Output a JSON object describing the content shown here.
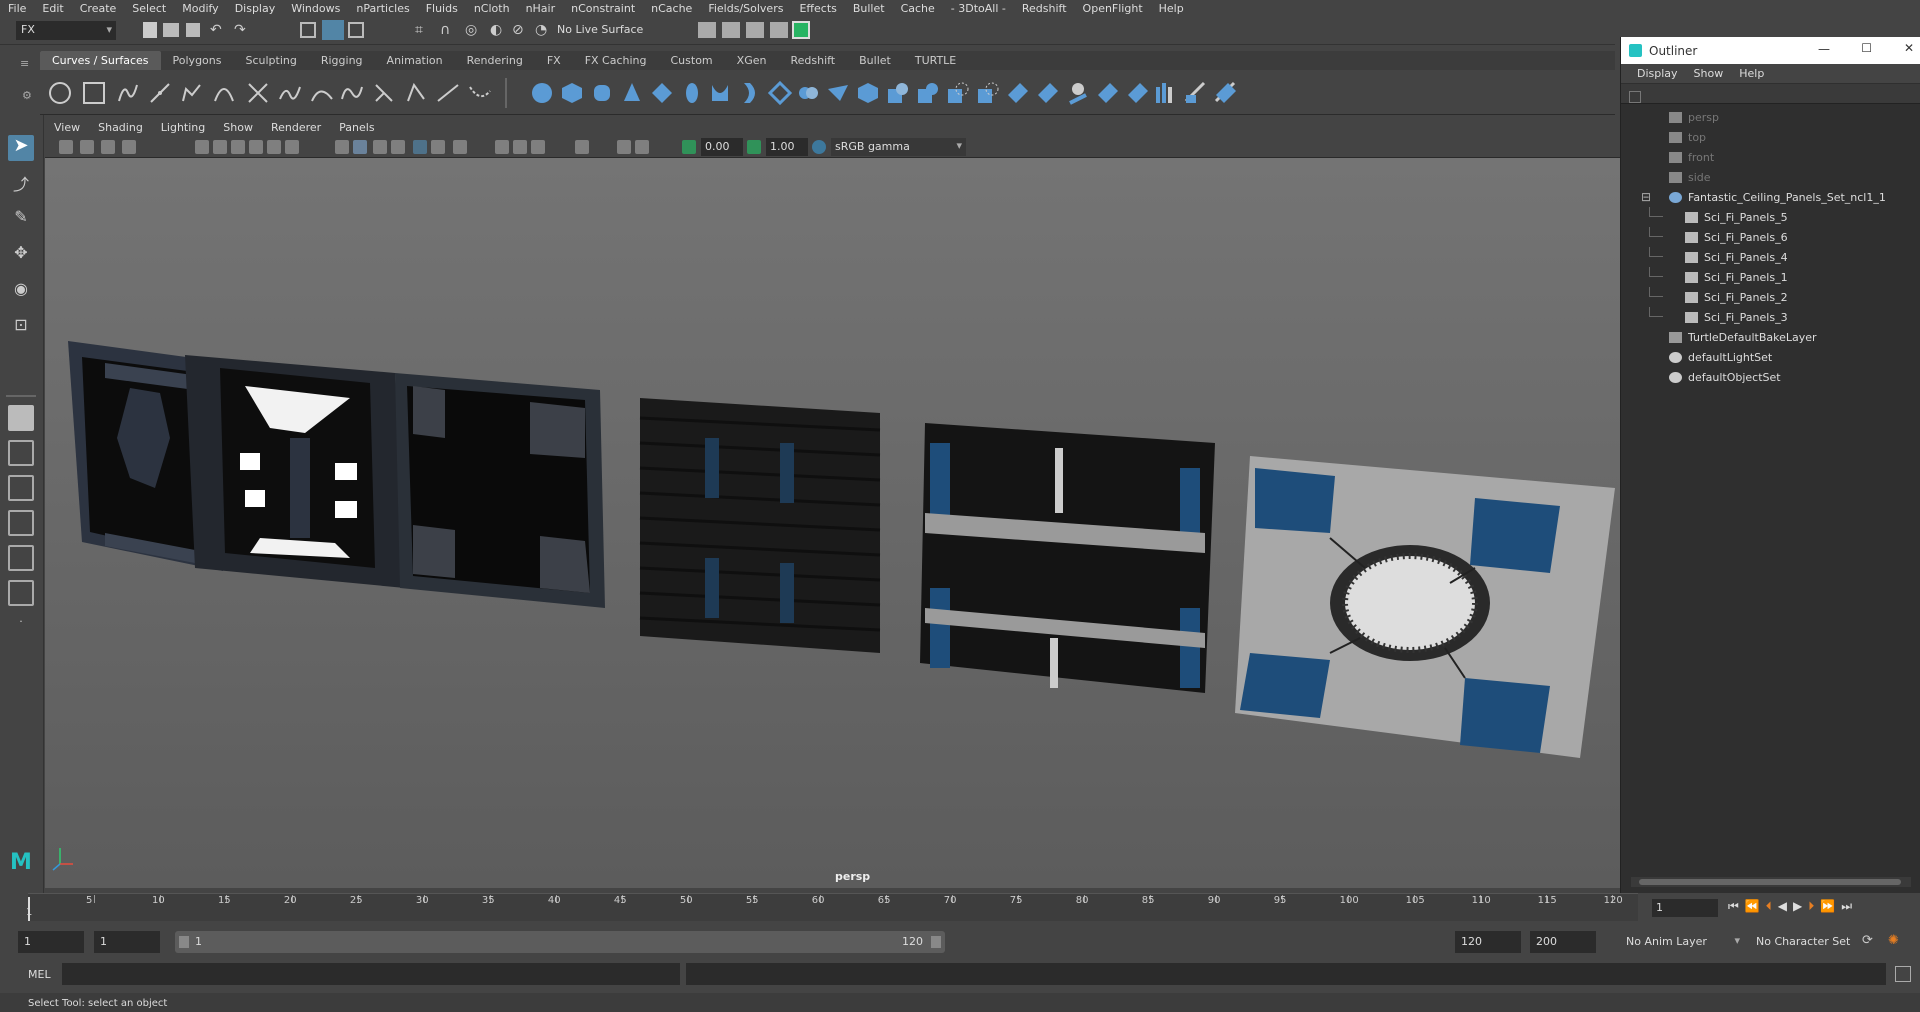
{
  "menubar": [
    "File",
    "Edit",
    "Create",
    "Select",
    "Modify",
    "Display",
    "Windows",
    "nParticles",
    "Fluids",
    "nCloth",
    "nHair",
    "nConstraint",
    "nCache",
    "Fields/Solvers",
    "Effects",
    "Bullet",
    "Cache",
    "- 3DtoAll -",
    "Redshift",
    "OpenFlight",
    "Help"
  ],
  "toolbar": {
    "menuset": "FX",
    "live_surface": "No Live Surface"
  },
  "shelf_tabs": [
    "Curves / Surfaces",
    "Polygons",
    "Sculpting",
    "Rigging",
    "Animation",
    "Rendering",
    "FX",
    "FX Caching",
    "Custom",
    "XGen",
    "Redshift",
    "Bullet",
    "TURTLE"
  ],
  "viewport": {
    "menu": [
      "View",
      "Shading",
      "Lighting",
      "Show",
      "Renderer",
      "Panels"
    ],
    "exposure": "0.00",
    "gamma": "1.00",
    "color_space": "sRGB gamma",
    "camera_label": "persp"
  },
  "outliner": {
    "title": "Outliner",
    "menu": [
      "Display",
      "Show",
      "Help"
    ],
    "items": [
      {
        "label": "persp",
        "type": "camera",
        "indent": 1,
        "dim": true
      },
      {
        "label": "top",
        "type": "camera",
        "indent": 1,
        "dim": true
      },
      {
        "label": "front",
        "type": "camera",
        "indent": 1,
        "dim": true
      },
      {
        "label": "side",
        "type": "camera",
        "indent": 1,
        "dim": true
      },
      {
        "label": "Fantastic_Ceiling_Panels_Set_ncl1_1",
        "type": "group",
        "indent": 0,
        "dim": false
      },
      {
        "label": "Sci_Fi_Panels_5",
        "type": "mesh",
        "indent": 2,
        "dim": false
      },
      {
        "label": "Sci_Fi_Panels_6",
        "type": "mesh",
        "indent": 2,
        "dim": false
      },
      {
        "label": "Sci_Fi_Panels_4",
        "type": "mesh",
        "indent": 2,
        "dim": false
      },
      {
        "label": "Sci_Fi_Panels_1",
        "type": "mesh",
        "indent": 2,
        "dim": false
      },
      {
        "label": "Sci_Fi_Panels_2",
        "type": "mesh",
        "indent": 2,
        "dim": false
      },
      {
        "label": "Sci_Fi_Panels_3",
        "type": "mesh",
        "indent": 2,
        "dim": false
      },
      {
        "label": "TurtleDefaultBakeLayer",
        "type": "layer",
        "indent": 1,
        "dim": false
      },
      {
        "label": "defaultLightSet",
        "type": "set",
        "indent": 1,
        "dim": false
      },
      {
        "label": "defaultObjectSet",
        "type": "set",
        "indent": 1,
        "dim": false
      }
    ]
  },
  "timeline": {
    "ticks": [
      "5",
      "10",
      "15",
      "20",
      "25",
      "30",
      "35",
      "40",
      "45",
      "50",
      "55",
      "60",
      "65",
      "70",
      "75",
      "80",
      "85",
      "90",
      "95",
      "100",
      "105",
      "110",
      "115",
      "120"
    ],
    "start_marker": "1",
    "current_frame": "1"
  },
  "range": {
    "start": "1",
    "playback_start": "1",
    "slider_start": "1",
    "slider_end": "120",
    "playback_end": "120",
    "end": "200",
    "anim_layer": "No Anim Layer",
    "character_set": "No Character Set"
  },
  "command_line": {
    "label": "MEL"
  },
  "help_line": "Select Tool: select an object",
  "colors": {
    "accent_blue": "#1e4d7a",
    "panel_dark": "#1f1f1f",
    "viewport_bg": "#6b6b6b"
  }
}
